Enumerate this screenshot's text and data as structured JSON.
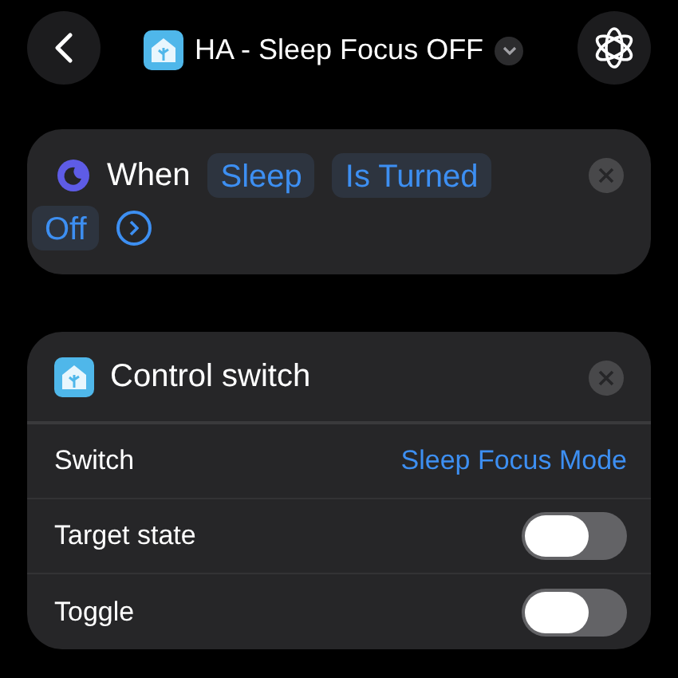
{
  "header": {
    "title": "HA - Sleep Focus OFF"
  },
  "trigger": {
    "label": "When",
    "tokens": [
      "Sleep",
      "Is Turned",
      "Off"
    ]
  },
  "action": {
    "title": "Control switch",
    "rows": [
      {
        "kind": "value",
        "label": "Switch",
        "value": "Sleep Focus Mode"
      },
      {
        "kind": "toggle",
        "label": "Target state",
        "on": false
      },
      {
        "kind": "toggle",
        "label": "Toggle",
        "on": false
      }
    ]
  }
}
